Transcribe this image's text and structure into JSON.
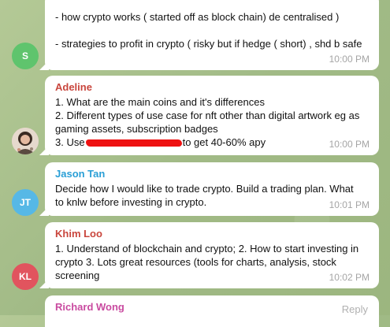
{
  "messages": [
    {
      "avatar_initial": "S",
      "avatar_color": "#5fc46d",
      "sender": "",
      "lines": [
        "- how crypto works ( started off as block chain) de centralised )",
        "",
        "- strategies to profit in crypto ( risky but if hedge ( short) , shd b safe"
      ],
      "time": "10:00 PM"
    },
    {
      "avatar_initial": "",
      "avatar_icon": "photo-avatar",
      "sender": "Adeline",
      "sender_color": "#c9463d",
      "lines": [
        "1. What are the main coins and it's differences",
        "2. Different types of use case for nft other than digital artwork eg as",
        "gaming assets, subscription badges"
      ],
      "redacted_line": {
        "before": "3. Use",
        "after": "to get 40-60% apy"
      },
      "time": "10:00 PM"
    },
    {
      "avatar_initial": "JT",
      "avatar_color": "#56b8e6",
      "sender": "Jason Tan",
      "sender_color": "#2a9fd6",
      "lines": [
        "Decide how I would like to trade  crypto. Build a trading plan.  What",
        "to knlw before investing in crypto."
      ],
      "time": "10:01 PM"
    },
    {
      "avatar_initial": "KL",
      "avatar_color": "#e1545e",
      "sender": "Khim Loo",
      "sender_color": "#c9463d",
      "lines": [
        "1. Understand of blockchain and crypto; 2. How to start investing in",
        "crypto 3. Lots great resources (tools for charts, analysis, stock",
        "screening"
      ],
      "time": "10:02 PM"
    },
    {
      "sender": "Richard Wong",
      "sender_color": "#c94ba0",
      "reply_label": "Reply"
    }
  ]
}
